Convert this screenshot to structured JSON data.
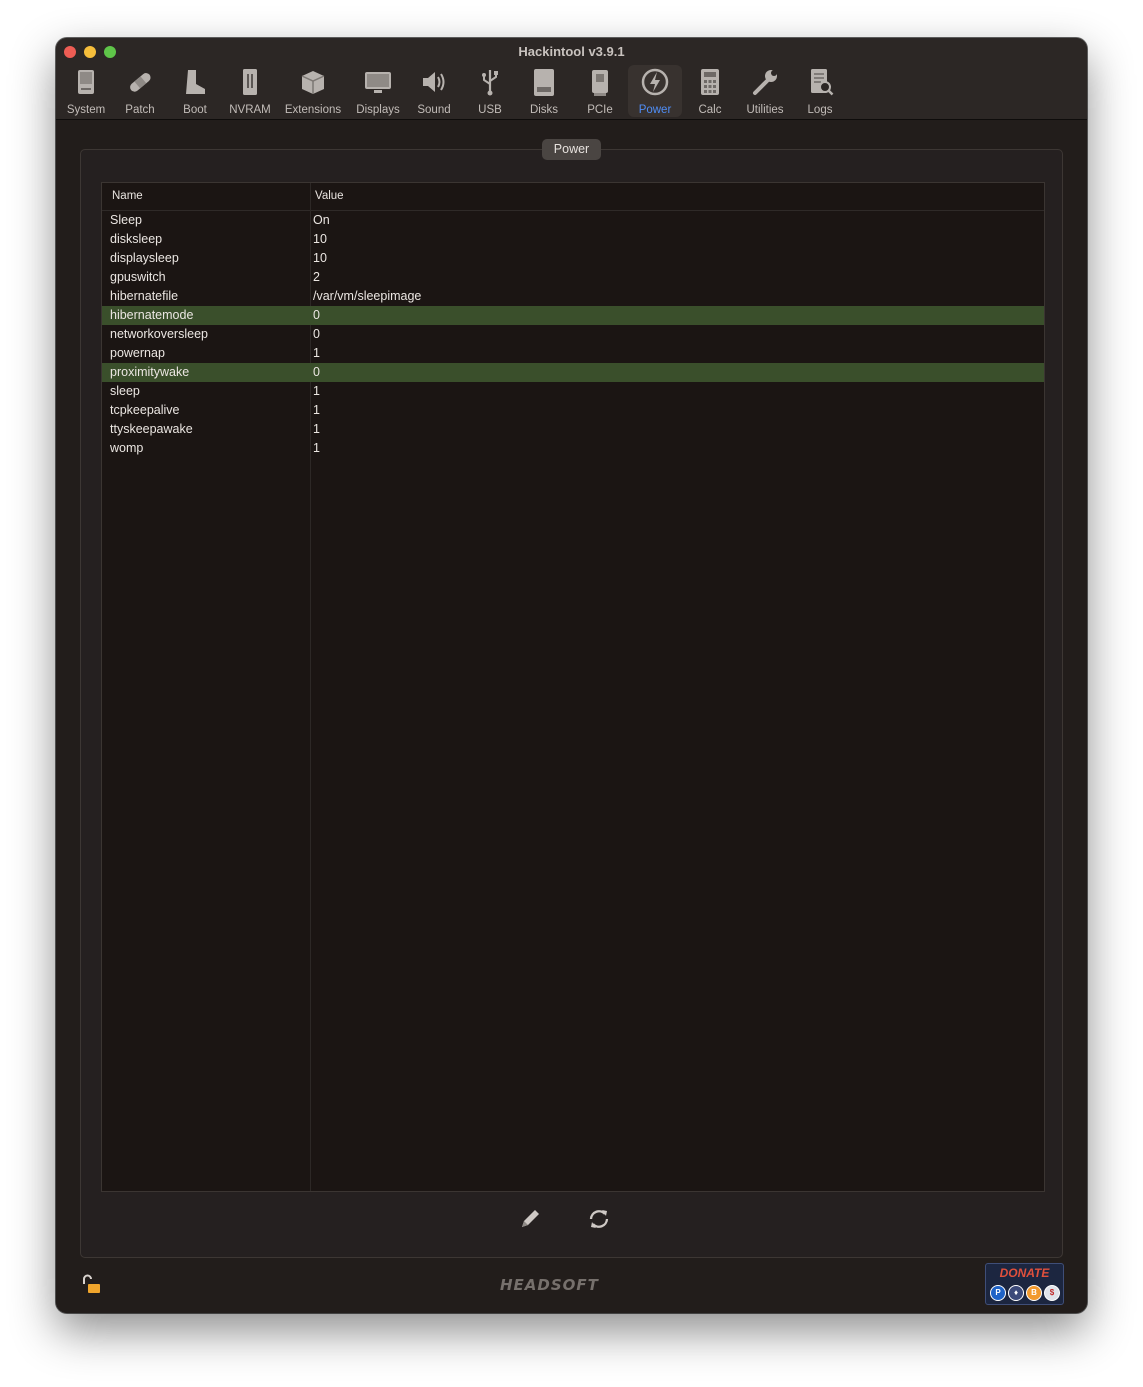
{
  "window": {
    "title": "Hackintool v3.9.1"
  },
  "toolbar": {
    "items": [
      {
        "label": "System",
        "icon": "system-icon"
      },
      {
        "label": "Patch",
        "icon": "bandage-icon"
      },
      {
        "label": "Boot",
        "icon": "boot-icon"
      },
      {
        "label": "NVRAM",
        "icon": "nvram-icon"
      },
      {
        "label": "Extensions",
        "icon": "extensions-icon"
      },
      {
        "label": "Displays",
        "icon": "display-icon"
      },
      {
        "label": "Sound",
        "icon": "speaker-icon"
      },
      {
        "label": "USB",
        "icon": "usb-icon"
      },
      {
        "label": "Disks",
        "icon": "disk-icon"
      },
      {
        "label": "PCIe",
        "icon": "pcie-icon"
      },
      {
        "label": "Power",
        "icon": "power-icon"
      },
      {
        "label": "Calc",
        "icon": "calculator-icon"
      },
      {
        "label": "Utilities",
        "icon": "wrench-icon"
      },
      {
        "label": "Logs",
        "icon": "logs-icon"
      }
    ],
    "active": "Power"
  },
  "section": {
    "title": "Power"
  },
  "table": {
    "headers": {
      "name": "Name",
      "value": "Value"
    },
    "rows": [
      {
        "name": "Sleep",
        "value": "On",
        "selected": false
      },
      {
        "name": "disksleep",
        "value": "10",
        "selected": false
      },
      {
        "name": "displaysleep",
        "value": "10",
        "selected": false
      },
      {
        "name": "gpuswitch",
        "value": "2",
        "selected": false
      },
      {
        "name": "hibernatefile",
        "value": "/var/vm/sleepimage",
        "selected": false
      },
      {
        "name": "hibernatemode",
        "value": "0",
        "selected": true
      },
      {
        "name": "networkoversleep",
        "value": "0",
        "selected": false
      },
      {
        "name": "powernap",
        "value": "1",
        "selected": false
      },
      {
        "name": "proximitywake",
        "value": "0",
        "selected": true
      },
      {
        "name": "sleep",
        "value": "1",
        "selected": false
      },
      {
        "name": "tcpkeepalive",
        "value": "1",
        "selected": false
      },
      {
        "name": "ttyskeepawake",
        "value": "1",
        "selected": false
      },
      {
        "name": "womp",
        "value": "1",
        "selected": false
      }
    ]
  },
  "footer": {
    "brand": "HEADSOFT",
    "donate_label": "DONATE",
    "actions": [
      "pencil-icon",
      "refresh-icon"
    ],
    "lock_icon": "unlocked-padlock-icon"
  },
  "colors": {
    "accent": "#4f8df5",
    "selection": "#3a4f2b",
    "donate_text": "#e0503c"
  }
}
